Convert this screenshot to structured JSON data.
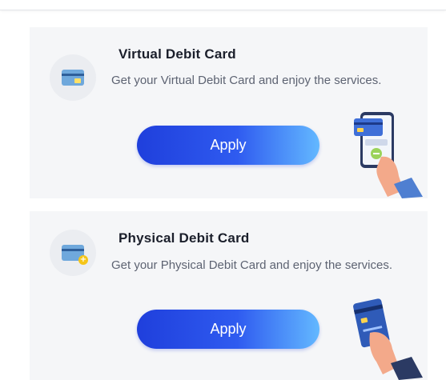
{
  "cards": [
    {
      "title": "Virtual Debit Card",
      "description": "Get your Virtual Debit Card and enjoy the services.",
      "button_label": "Apply",
      "icon": "credit-card-icon",
      "illustration": "hand-holding-phone-illustration"
    },
    {
      "title": "Physical Debit Card",
      "description": "Get your Physical Debit Card and enjoy the services.",
      "button_label": "Apply",
      "icon": "credit-card-add-icon",
      "illustration": "hand-holding-card-illustration"
    }
  ],
  "colors": {
    "card_background": "#f5f6f8",
    "button_gradient_start": "#1f3fdc",
    "button_gradient_end": "#63b8ff",
    "title_text": "#1b1f2b",
    "body_text": "#5d6372"
  }
}
